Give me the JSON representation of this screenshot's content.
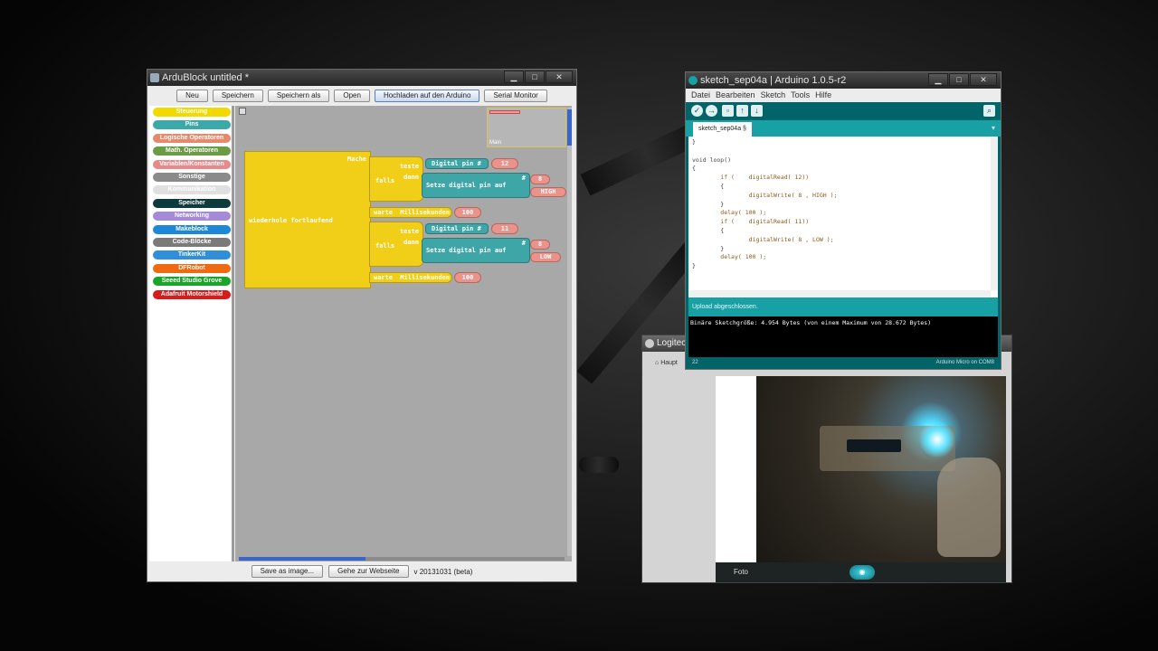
{
  "ardublock": {
    "title": "ArduBlock untitled *",
    "toolbar": {
      "new": "Neu",
      "save": "Speichern",
      "save_as": "Speichern als",
      "open": "Open",
      "upload": "Hochladen auf den Arduino",
      "serial": "Serial Monitor"
    },
    "categories": [
      {
        "label": "Steuerung",
        "color": "#f2d900"
      },
      {
        "label": "Pins",
        "color": "#3ba8aa"
      },
      {
        "label": "Logische Operatoren",
        "color": "#e58a6c"
      },
      {
        "label": "Math. Operatoren",
        "color": "#6a9b45"
      },
      {
        "label": "Variablen/Konstanten",
        "color": "#e88a8a"
      },
      {
        "label": "Sonstige",
        "color": "#8a8a8a"
      },
      {
        "label": "Kommunikation",
        "color": "#e0e0e0"
      },
      {
        "label": "Speicher",
        "color": "#0d3b3b"
      },
      {
        "label": "Networking",
        "color": "#a58ad8"
      },
      {
        "label": "Makeblock",
        "color": "#1e88d8"
      },
      {
        "label": "Code-Blöcke",
        "color": "#7a7a7a"
      },
      {
        "label": "TinkerKit",
        "color": "#2f8fd8"
      },
      {
        "label": "DFRobot",
        "color": "#f06a10"
      },
      {
        "label": "Seeed Studio Grove",
        "color": "#1aa52a"
      },
      {
        "label": "Adafruit Motorshield",
        "color": "#d81c1c"
      }
    ],
    "blocks": {
      "main": "Mache",
      "loop": "wiederhole fortlaufend",
      "if1": "falls",
      "test1": "teste",
      "then1": "dann",
      "dread1": "Digital pin #",
      "dread1_pin": "12",
      "write1": "Setze digital pin auf",
      "write1_hash": "#",
      "write1_pin": "8",
      "write1_val": "HIGH",
      "wait1": "warte",
      "wait1_ms": "Millisekunden",
      "wait1_val": "100",
      "if2": "falls",
      "test2": "teste",
      "then2": "dann",
      "dread2": "Digital pin #",
      "dread2_pin": "11",
      "write2": "Setze digital pin auf",
      "write2_hash": "#",
      "write2_pin": "8",
      "write2_val": "LOW",
      "wait2": "warte",
      "wait2_ms": "Millisekunden",
      "wait2_val": "100"
    },
    "minimap_label": "Main",
    "status": {
      "save_image": "Save as image...",
      "website": "Gehe zur Webseite",
      "version": "v 20131031 (beta)"
    }
  },
  "arduino": {
    "title": "sketch_sep04a | Arduino 1.0.5-r2",
    "menu": [
      "Datei",
      "Bearbeiten",
      "Sketch",
      "Tools",
      "Hilfe"
    ],
    "tab": "sketch_sep04a §",
    "code": [
      "}",
      "",
      "void loop()",
      "{",
      "        if (    digitalRead( 12))",
      "        {",
      "                digitalWrite( 8 , HIGH );",
      "        }",
      "        delay( 100 );",
      "        if (    digitalRead( 11))",
      "        {",
      "                digitalWrite( 8 , LOW );",
      "        }",
      "        delay( 100 );",
      "}"
    ],
    "status": "Upload abgeschlossen.",
    "console": "Binäre Sketchgröße: 4.954 Bytes (von einem Maximum von 28.672 Bytes)",
    "line": "22",
    "board": "Arduino Micro on COM8"
  },
  "logitech": {
    "title": "Logitech",
    "nav": "Haupt",
    "foto": "Foto"
  }
}
